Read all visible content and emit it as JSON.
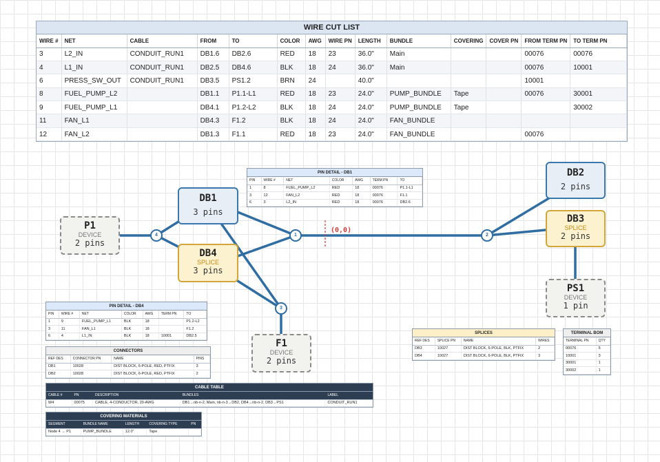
{
  "wire_cut_list": {
    "title": "WIRE CUT LIST",
    "headers": [
      "WIRE #",
      "NET",
      "CABLE",
      "FROM",
      "TO",
      "COLOR",
      "AWG",
      "WIRE PN",
      "LENGTH",
      "BUNDLE",
      "COVERING",
      "COVER PN",
      "FROM TERM PN",
      "TO TERM PN"
    ],
    "rows": [
      [
        "3",
        "L2_IN",
        "CONDUIT_RUN1",
        "DB1.6",
        "DB2.6",
        "RED",
        "18",
        "23",
        "36.0\"",
        "Main",
        "",
        "",
        "00076",
        "00076"
      ],
      [
        "4",
        "L1_IN",
        "CONDUIT_RUN1",
        "DB2.5",
        "DB4.6",
        "BLK",
        "18",
        "24",
        "36.0\"",
        "Main",
        "",
        "",
        "00076",
        "10001"
      ],
      [
        "6",
        "PRESS_SW_OUT",
        "CONDUIT_RUN1",
        "DB3.5",
        "PS1.2",
        "BRN",
        "24",
        "",
        "40.0\"",
        "",
        "",
        "",
        "10001",
        ""
      ],
      [
        "8",
        "FUEL_PUMP_L2",
        "",
        "DB1.1",
        "P1.1-L1",
        "RED",
        "18",
        "23",
        "24.0\"",
        "PUMP_BUNDLE",
        "Tape",
        "",
        "00076",
        "30001"
      ],
      [
        "9",
        "FUEL_PUMP_L1",
        "",
        "DB4.1",
        "P1.2-L2",
        "BLK",
        "18",
        "24",
        "24.0\"",
        "PUMP_BUNDLE",
        "Tape",
        "",
        "",
        "30002"
      ],
      [
        "11",
        "FAN_L1",
        "",
        "DB4.3",
        "F1.2",
        "BLK",
        "18",
        "24",
        "24.0\"",
        "FAN_BUNDLE",
        "",
        "",
        "",
        ""
      ],
      [
        "12",
        "FAN_L2",
        "",
        "DB1.3",
        "F1.1",
        "RED",
        "18",
        "23",
        "24.0\"",
        "FAN_BUNDLE",
        "",
        "",
        "00076",
        ""
      ]
    ]
  },
  "pin_detail_db1": {
    "title": "PIN DETAIL - DB1",
    "headers": [
      "PIN",
      "WIRE #",
      "NET",
      "COLOR",
      "AWG",
      "TERM PN",
      "TO"
    ],
    "rows": [
      [
        "1",
        "8",
        "FUEL_PUMP_L2",
        "RED",
        "18",
        "00076",
        "P1.1-L1"
      ],
      [
        "3",
        "12",
        "FAN_L2",
        "RED",
        "18",
        "00076",
        "F1.1"
      ],
      [
        "6",
        "3",
        "L2_IN",
        "RED",
        "18",
        "00076",
        "DB2.6"
      ]
    ]
  },
  "pin_detail_db4": {
    "title": "PIN DETAIL - DB4",
    "headers": [
      "PIN",
      "WIRE #",
      "NET",
      "COLOR",
      "AWG",
      "TERM PN",
      "TO"
    ],
    "rows": [
      [
        "1",
        "9",
        "FUEL_PUMP_L1",
        "BLK",
        "18",
        "",
        "P1.2-L2"
      ],
      [
        "3",
        "11",
        "FAN_L1",
        "BLK",
        "18",
        "",
        "F1.2"
      ],
      [
        "6",
        "4",
        "L1_IN",
        "BLK",
        "18",
        "10001",
        "DB2.5"
      ]
    ]
  },
  "connectors": {
    "title": "CONNECTORS",
    "headers": [
      "REF DES",
      "CONNECTOR PN",
      "NAME",
      "PINS"
    ],
    "rows": [
      [
        "DB1",
        "10028",
        "DIST BLOCK, 6-POLE, RED, PTFIX",
        "3"
      ],
      [
        "DB2",
        "10028",
        "DIST BLOCK, 6-POLE, RED, PTFIX",
        "2"
      ]
    ]
  },
  "cable_table": {
    "title": "CABLE TABLE",
    "headers": [
      "CABLE #",
      "PN",
      "DESCRIPTION",
      "BUNDLES",
      "LABEL"
    ],
    "rows": [
      [
        "W4",
        "00075",
        "CABLE, 4-CONDUCTOR, 20-AWG",
        "DB1→nb-n-2, Main, nb-n-3→DB2, DB4→nb-n-2, DB3→PS1",
        "CONDUIT_RUN1"
      ]
    ]
  },
  "covering_materials": {
    "title": "COVERING MATERIALS",
    "headers": [
      "SEGMENT",
      "BUNDLE NAME",
      "LENGTH",
      "COVERING TYPE",
      "PN"
    ],
    "rows": [
      [
        "Node 4 → P1",
        "PUMP_BUNDLE",
        "12.0\"",
        "Tape",
        ""
      ]
    ]
  },
  "splices": {
    "title": "SPLICES",
    "headers": [
      "REF DES",
      "SPLICE PN",
      "NAME",
      "WIRES"
    ],
    "rows": [
      [
        "DB3",
        "10027",
        "DIST BLOCK, 6-POLE, BLK, PTFIX",
        "2"
      ],
      [
        "DB4",
        "10027",
        "DIST BLOCK, 6-POLE, BLK, PTFIX",
        "3"
      ]
    ]
  },
  "terminal_bom": {
    "title": "TERMINAL BOM",
    "headers": [
      "TERMINAL PN",
      "QTY"
    ],
    "rows": [
      [
        "00076",
        "5"
      ],
      [
        "10001",
        "3"
      ],
      [
        "30001",
        "1"
      ],
      [
        "30002",
        "1"
      ]
    ]
  },
  "nodes": {
    "db1": {
      "name": "DB1",
      "pins": "3 pins"
    },
    "db2": {
      "name": "DB2",
      "pins": "2 pins"
    },
    "db3": {
      "name": "DB3",
      "type": "SPLICE",
      "pins": "2 pins"
    },
    "db4": {
      "name": "DB4",
      "type": "SPLICE",
      "pins": "3 pins"
    },
    "p1": {
      "name": "P1",
      "type": "DEVICE",
      "pins": "2 pins"
    },
    "f1": {
      "name": "F1",
      "type": "DEVICE",
      "pins": "2 pins"
    },
    "ps1": {
      "name": "PS1",
      "type": "DEVICE",
      "pins": "1 pin"
    }
  },
  "bundle_nodes": {
    "n1": "1",
    "n2": "2",
    "n3": "3",
    "n4": "4"
  },
  "origin_label": "(0,0)",
  "colors": {
    "wire": "#2f6da3",
    "connector_border": "#3a77ad",
    "splice_border": "#d4a53a",
    "origin": "#d23a3a"
  }
}
